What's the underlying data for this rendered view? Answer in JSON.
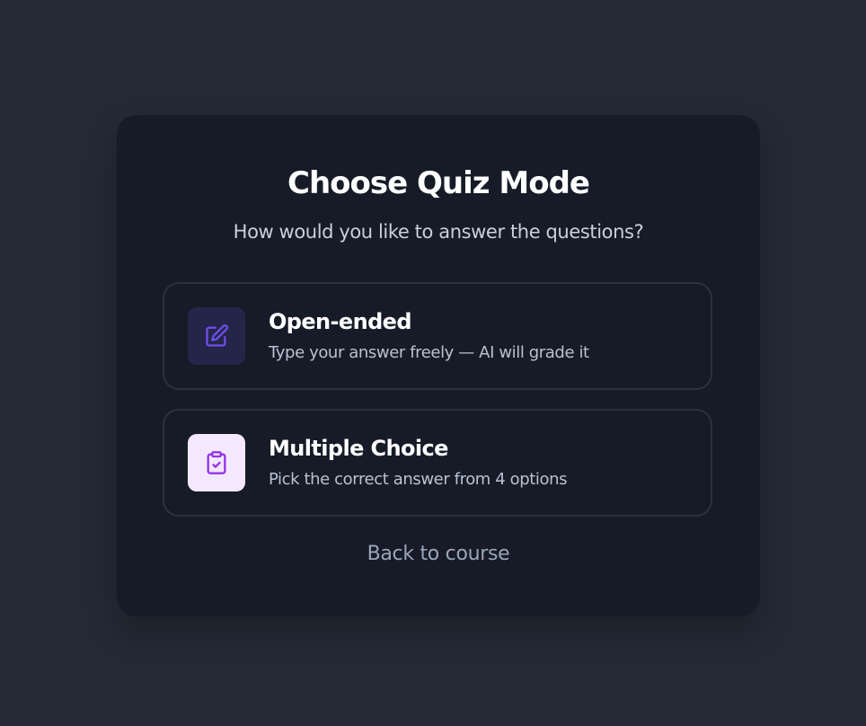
{
  "modal": {
    "title": "Choose Quiz Mode",
    "subtitle": "How would you like to answer the questions?",
    "options": [
      {
        "icon": "edit-icon",
        "title": "Open-ended",
        "description": "Type your answer freely — AI will grade it"
      },
      {
        "icon": "clipboard-check-icon",
        "title": "Multiple Choice",
        "description": "Pick the correct answer from 4 options"
      }
    ],
    "back_label": "Back to course"
  },
  "colors": {
    "background": "#242a36",
    "modal": "#161b27",
    "accent_open": "#6d4ee8",
    "accent_multiple": "#9333ea"
  }
}
